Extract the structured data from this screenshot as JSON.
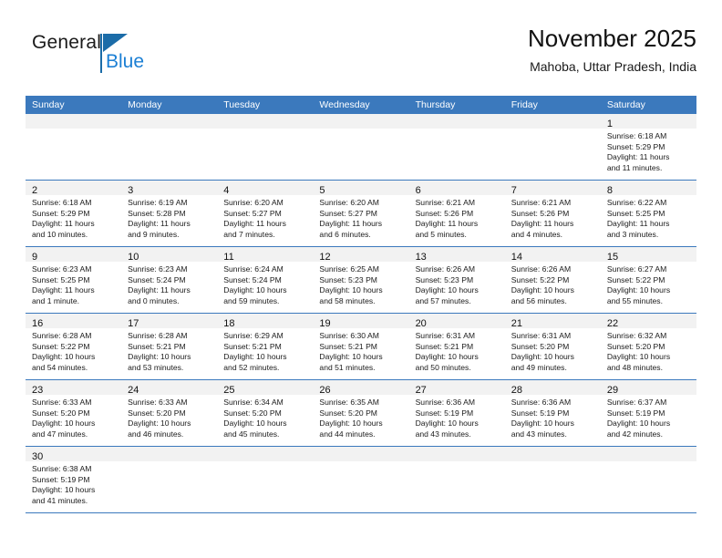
{
  "brand": {
    "name_part1": "General",
    "name_part2": "Blue",
    "triangle_color": "#1b6ca8",
    "blue_text_color": "#1b7fd4"
  },
  "header": {
    "title": "November 2025",
    "subtitle": "Mahoba, Uttar Pradesh, India"
  },
  "theme": {
    "header_bar_color": "#3b79bd",
    "row_divider_color": "#3b79bd",
    "day_band_color": "#f2f2f2"
  },
  "weekdays": [
    "Sunday",
    "Monday",
    "Tuesday",
    "Wednesday",
    "Thursday",
    "Friday",
    "Saturday"
  ],
  "weeks": [
    [
      {
        "empty": true
      },
      {
        "empty": true
      },
      {
        "empty": true
      },
      {
        "empty": true
      },
      {
        "empty": true
      },
      {
        "empty": true
      },
      {
        "day": "1",
        "sunrise": "Sunrise: 6:18 AM",
        "sunset": "Sunset: 5:29 PM",
        "daylight1": "Daylight: 11 hours",
        "daylight2": "and 11 minutes."
      }
    ],
    [
      {
        "day": "2",
        "sunrise": "Sunrise: 6:18 AM",
        "sunset": "Sunset: 5:29 PM",
        "daylight1": "Daylight: 11 hours",
        "daylight2": "and 10 minutes."
      },
      {
        "day": "3",
        "sunrise": "Sunrise: 6:19 AM",
        "sunset": "Sunset: 5:28 PM",
        "daylight1": "Daylight: 11 hours",
        "daylight2": "and 9 minutes."
      },
      {
        "day": "4",
        "sunrise": "Sunrise: 6:20 AM",
        "sunset": "Sunset: 5:27 PM",
        "daylight1": "Daylight: 11 hours",
        "daylight2": "and 7 minutes."
      },
      {
        "day": "5",
        "sunrise": "Sunrise: 6:20 AM",
        "sunset": "Sunset: 5:27 PM",
        "daylight1": "Daylight: 11 hours",
        "daylight2": "and 6 minutes."
      },
      {
        "day": "6",
        "sunrise": "Sunrise: 6:21 AM",
        "sunset": "Sunset: 5:26 PM",
        "daylight1": "Daylight: 11 hours",
        "daylight2": "and 5 minutes."
      },
      {
        "day": "7",
        "sunrise": "Sunrise: 6:21 AM",
        "sunset": "Sunset: 5:26 PM",
        "daylight1": "Daylight: 11 hours",
        "daylight2": "and 4 minutes."
      },
      {
        "day": "8",
        "sunrise": "Sunrise: 6:22 AM",
        "sunset": "Sunset: 5:25 PM",
        "daylight1": "Daylight: 11 hours",
        "daylight2": "and 3 minutes."
      }
    ],
    [
      {
        "day": "9",
        "sunrise": "Sunrise: 6:23 AM",
        "sunset": "Sunset: 5:25 PM",
        "daylight1": "Daylight: 11 hours",
        "daylight2": "and 1 minute."
      },
      {
        "day": "10",
        "sunrise": "Sunrise: 6:23 AM",
        "sunset": "Sunset: 5:24 PM",
        "daylight1": "Daylight: 11 hours",
        "daylight2": "and 0 minutes."
      },
      {
        "day": "11",
        "sunrise": "Sunrise: 6:24 AM",
        "sunset": "Sunset: 5:24 PM",
        "daylight1": "Daylight: 10 hours",
        "daylight2": "and 59 minutes."
      },
      {
        "day": "12",
        "sunrise": "Sunrise: 6:25 AM",
        "sunset": "Sunset: 5:23 PM",
        "daylight1": "Daylight: 10 hours",
        "daylight2": "and 58 minutes."
      },
      {
        "day": "13",
        "sunrise": "Sunrise: 6:26 AM",
        "sunset": "Sunset: 5:23 PM",
        "daylight1": "Daylight: 10 hours",
        "daylight2": "and 57 minutes."
      },
      {
        "day": "14",
        "sunrise": "Sunrise: 6:26 AM",
        "sunset": "Sunset: 5:22 PM",
        "daylight1": "Daylight: 10 hours",
        "daylight2": "and 56 minutes."
      },
      {
        "day": "15",
        "sunrise": "Sunrise: 6:27 AM",
        "sunset": "Sunset: 5:22 PM",
        "daylight1": "Daylight: 10 hours",
        "daylight2": "and 55 minutes."
      }
    ],
    [
      {
        "day": "16",
        "sunrise": "Sunrise: 6:28 AM",
        "sunset": "Sunset: 5:22 PM",
        "daylight1": "Daylight: 10 hours",
        "daylight2": "and 54 minutes."
      },
      {
        "day": "17",
        "sunrise": "Sunrise: 6:28 AM",
        "sunset": "Sunset: 5:21 PM",
        "daylight1": "Daylight: 10 hours",
        "daylight2": "and 53 minutes."
      },
      {
        "day": "18",
        "sunrise": "Sunrise: 6:29 AM",
        "sunset": "Sunset: 5:21 PM",
        "daylight1": "Daylight: 10 hours",
        "daylight2": "and 52 minutes."
      },
      {
        "day": "19",
        "sunrise": "Sunrise: 6:30 AM",
        "sunset": "Sunset: 5:21 PM",
        "daylight1": "Daylight: 10 hours",
        "daylight2": "and 51 minutes."
      },
      {
        "day": "20",
        "sunrise": "Sunrise: 6:31 AM",
        "sunset": "Sunset: 5:21 PM",
        "daylight1": "Daylight: 10 hours",
        "daylight2": "and 50 minutes."
      },
      {
        "day": "21",
        "sunrise": "Sunrise: 6:31 AM",
        "sunset": "Sunset: 5:20 PM",
        "daylight1": "Daylight: 10 hours",
        "daylight2": "and 49 minutes."
      },
      {
        "day": "22",
        "sunrise": "Sunrise: 6:32 AM",
        "sunset": "Sunset: 5:20 PM",
        "daylight1": "Daylight: 10 hours",
        "daylight2": "and 48 minutes."
      }
    ],
    [
      {
        "day": "23",
        "sunrise": "Sunrise: 6:33 AM",
        "sunset": "Sunset: 5:20 PM",
        "daylight1": "Daylight: 10 hours",
        "daylight2": "and 47 minutes."
      },
      {
        "day": "24",
        "sunrise": "Sunrise: 6:33 AM",
        "sunset": "Sunset: 5:20 PM",
        "daylight1": "Daylight: 10 hours",
        "daylight2": "and 46 minutes."
      },
      {
        "day": "25",
        "sunrise": "Sunrise: 6:34 AM",
        "sunset": "Sunset: 5:20 PM",
        "daylight1": "Daylight: 10 hours",
        "daylight2": "and 45 minutes."
      },
      {
        "day": "26",
        "sunrise": "Sunrise: 6:35 AM",
        "sunset": "Sunset: 5:20 PM",
        "daylight1": "Daylight: 10 hours",
        "daylight2": "and 44 minutes."
      },
      {
        "day": "27",
        "sunrise": "Sunrise: 6:36 AM",
        "sunset": "Sunset: 5:19 PM",
        "daylight1": "Daylight: 10 hours",
        "daylight2": "and 43 minutes."
      },
      {
        "day": "28",
        "sunrise": "Sunrise: 6:36 AM",
        "sunset": "Sunset: 5:19 PM",
        "daylight1": "Daylight: 10 hours",
        "daylight2": "and 43 minutes."
      },
      {
        "day": "29",
        "sunrise": "Sunrise: 6:37 AM",
        "sunset": "Sunset: 5:19 PM",
        "daylight1": "Daylight: 10 hours",
        "daylight2": "and 42 minutes."
      }
    ],
    [
      {
        "day": "30",
        "sunrise": "Sunrise: 6:38 AM",
        "sunset": "Sunset: 5:19 PM",
        "daylight1": "Daylight: 10 hours",
        "daylight2": "and 41 minutes."
      },
      {
        "empty": true
      },
      {
        "empty": true
      },
      {
        "empty": true
      },
      {
        "empty": true
      },
      {
        "empty": true
      },
      {
        "empty": true
      }
    ]
  ]
}
